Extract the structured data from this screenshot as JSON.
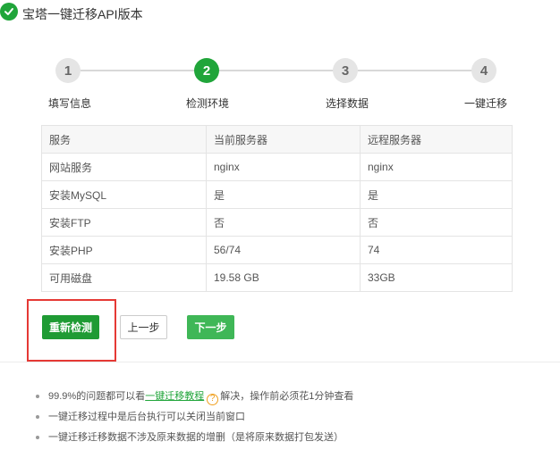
{
  "window": {
    "title": "宝塔一键迁移API版本"
  },
  "steps": [
    {
      "number": "1",
      "label": "填写信息"
    },
    {
      "number": "2",
      "label": "检测环境"
    },
    {
      "number": "3",
      "label": "选择数据"
    },
    {
      "number": "4",
      "label": "一键迁移"
    }
  ],
  "current_step": 2,
  "table": {
    "headers": [
      "服务",
      "当前服务器",
      "远程服务器"
    ],
    "rows": [
      [
        "网站服务",
        "nginx",
        "nginx"
      ],
      [
        "安装MySQL",
        "是",
        "是"
      ],
      [
        "安装FTP",
        "否",
        "否"
      ],
      [
        "安装PHP",
        "56/74",
        "74"
      ],
      [
        "可用磁盘",
        "19.58 GB",
        "33GB"
      ]
    ]
  },
  "buttons": {
    "recheck": "重新检测",
    "prev": "上一步",
    "next": "下一步"
  },
  "tips": {
    "tip1_before": "99.9%的问题都可以看",
    "tip1_link": "一键迁移教程",
    "tip1_help": "?",
    "tip1_after": "解决，操作前必须花1分钟查看",
    "tip2": "一键迁移过程中是后台执行可以关闭当前窗口",
    "tip3": "一键迁移迁移数据不涉及原来数据的增删（是将原来数据打包发送）"
  },
  "colors": {
    "accent": "#20a53a",
    "highlight": "#e53935"
  }
}
